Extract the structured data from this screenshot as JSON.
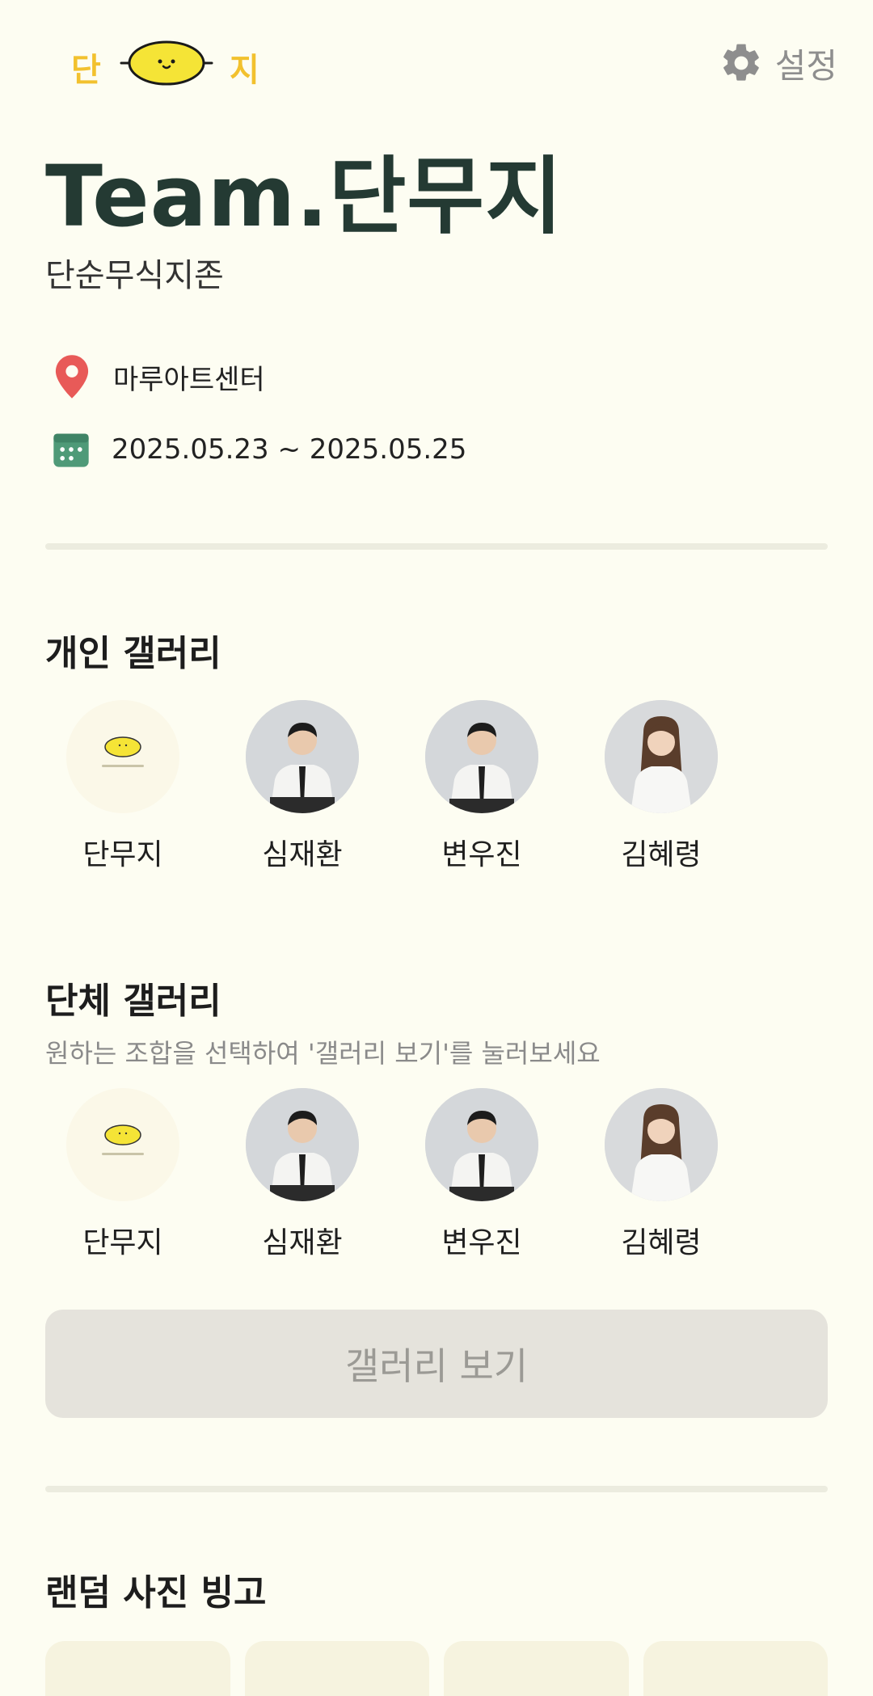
{
  "header": {
    "logo_left": "단",
    "logo_right": "지",
    "settings_label": "설정"
  },
  "team": {
    "title": "Team.단무지",
    "subtitle": "단순무식지존",
    "location": "마루아트센터",
    "date_range": "2025.05.23 ~ 2025.05.25"
  },
  "personal_gallery": {
    "title": "개인 갤러리",
    "members": [
      {
        "name": "단무지",
        "avatar": "lemon"
      },
      {
        "name": "심재환",
        "avatar": "photo-man"
      },
      {
        "name": "변우진",
        "avatar": "photo-man"
      },
      {
        "name": "김혜령",
        "avatar": "photo-woman"
      }
    ]
  },
  "group_gallery": {
    "title": "단체 갤러리",
    "description": "원하는 조합을 선택하여 '갤러리 보기'를 눌러보세요",
    "members": [
      {
        "name": "단무지",
        "avatar": "lemon"
      },
      {
        "name": "심재환",
        "avatar": "photo-man"
      },
      {
        "name": "변우진",
        "avatar": "photo-man"
      },
      {
        "name": "김혜령",
        "avatar": "photo-woman"
      }
    ],
    "button_label": "갤러리 보기"
  },
  "bingo": {
    "title": "랜덤 사진 빙고"
  },
  "colors": {
    "background": "#fdfdf2",
    "title": "#243a33",
    "logo_yellow": "#f2c12e",
    "location_pin": "#e85a58",
    "calendar": "#4f9a78",
    "button_disabled": "#e5e3dc"
  },
  "icons": {
    "settings": "gear-icon",
    "location": "location-pin-icon",
    "date": "calendar-icon",
    "logo": "lemon-mascot-icon"
  }
}
